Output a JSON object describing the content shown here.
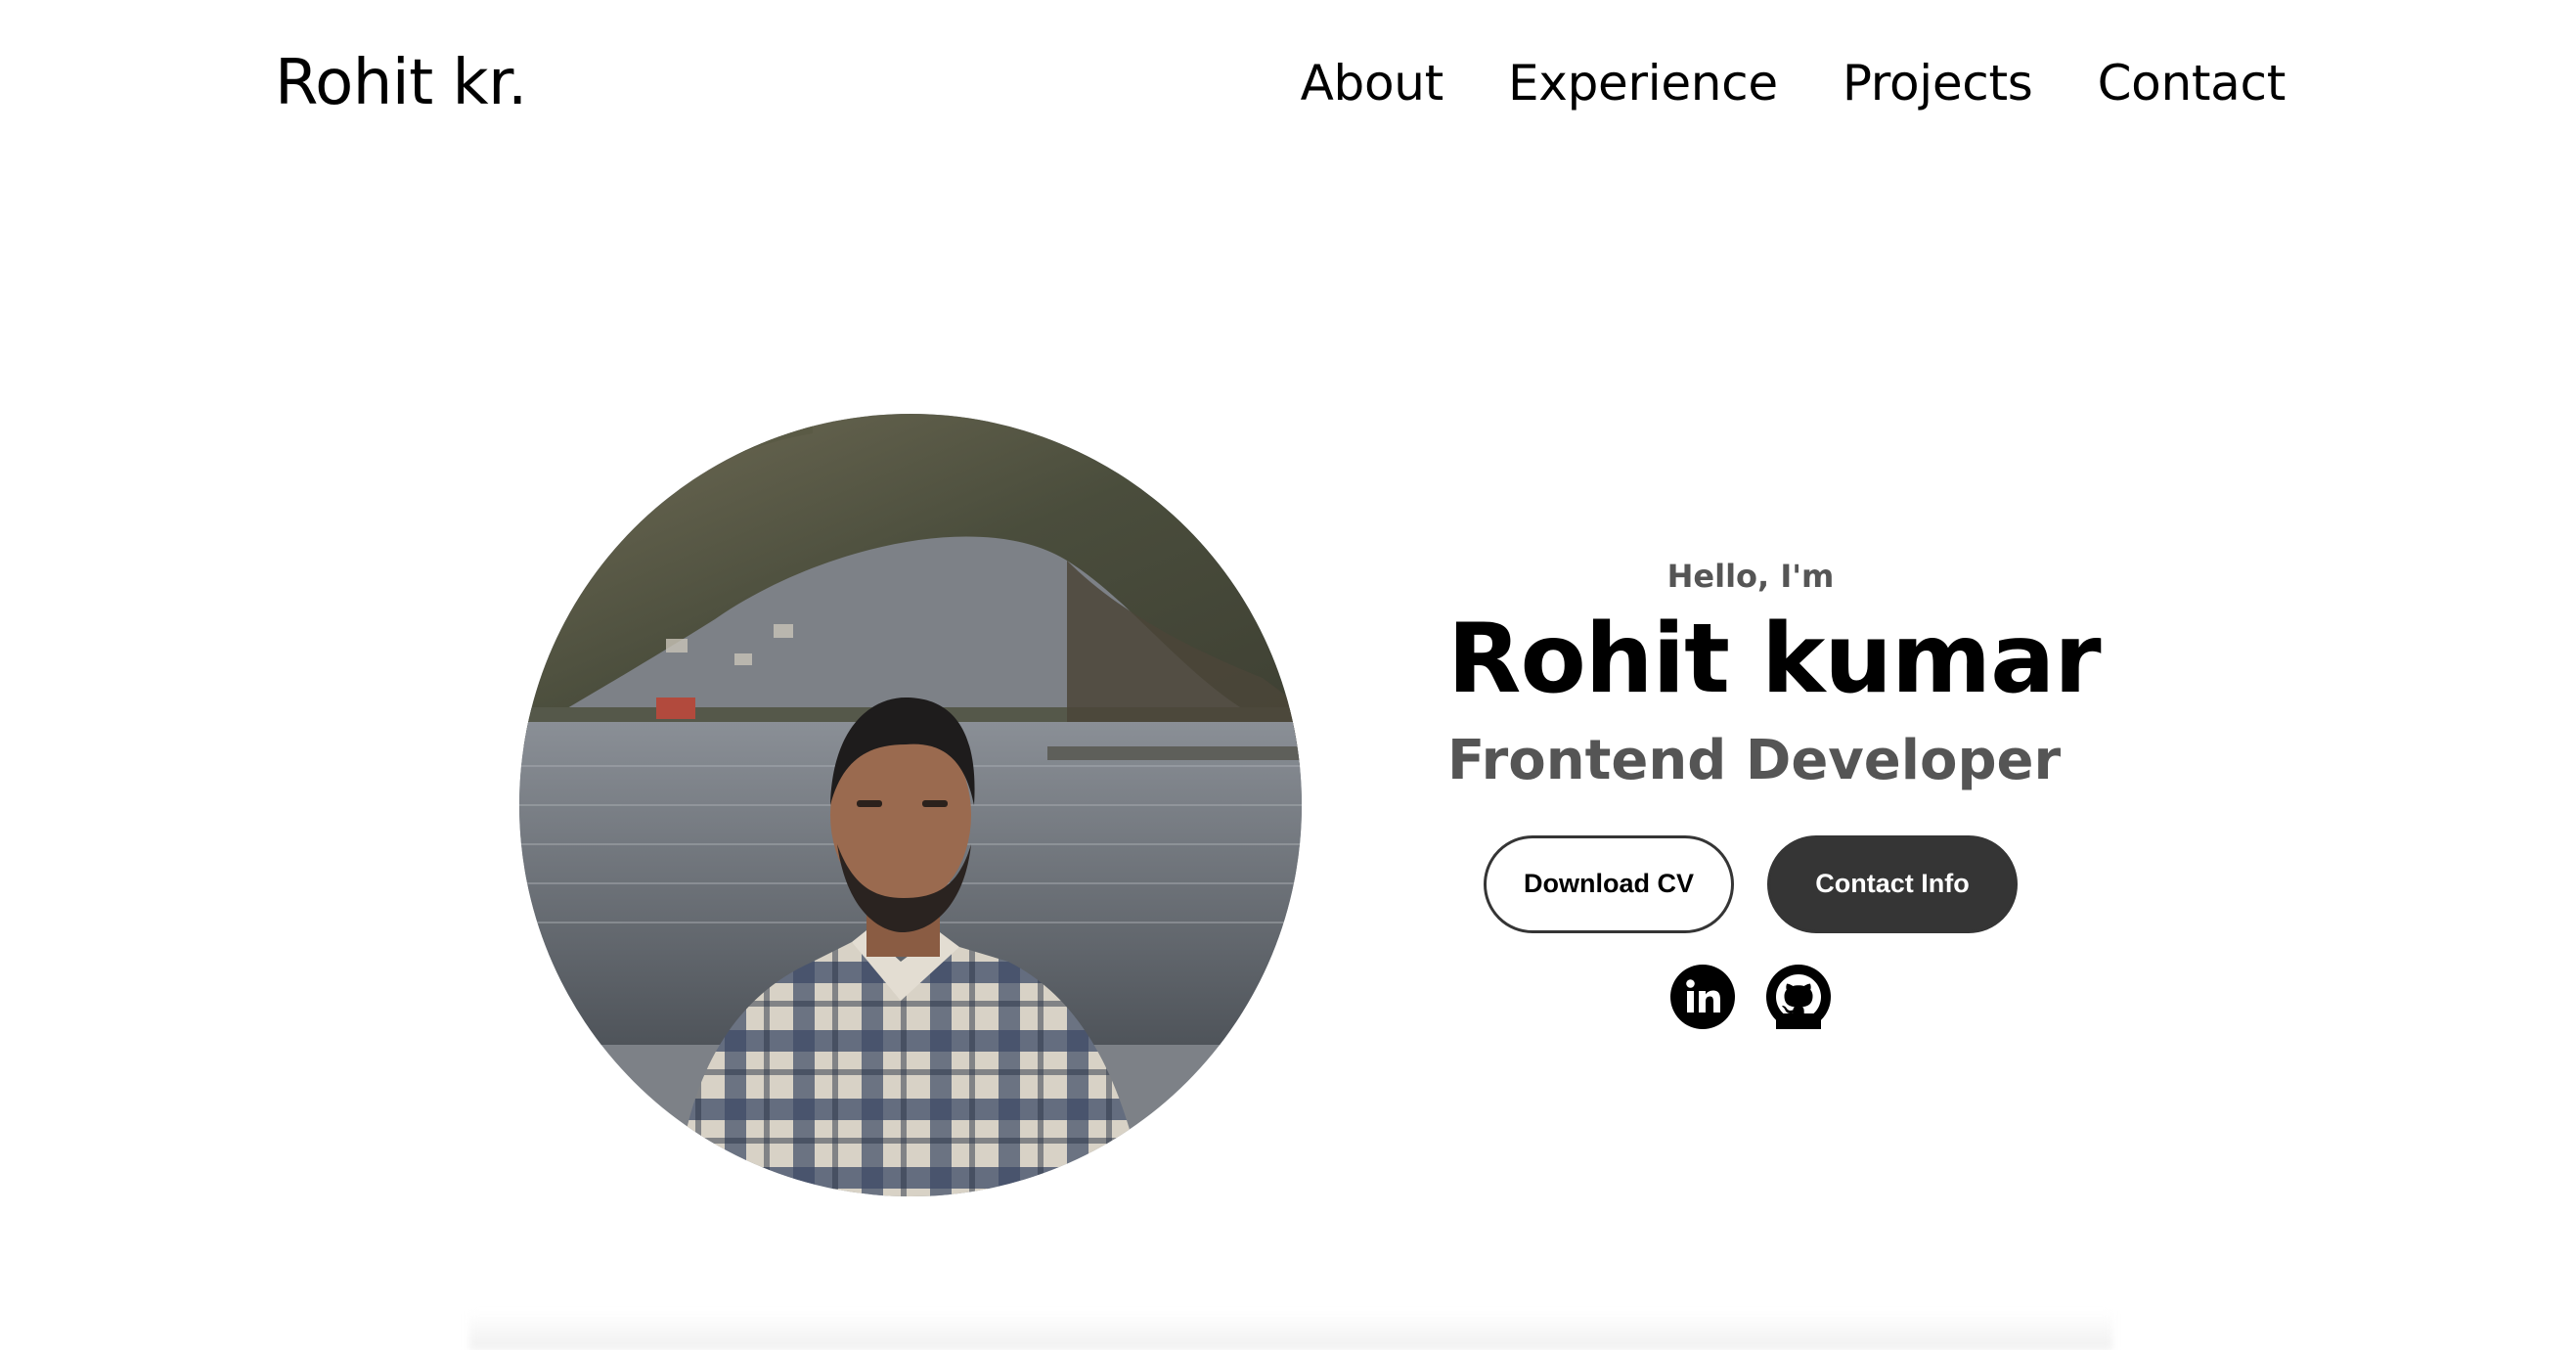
{
  "header": {
    "logo": "Rohit kr.",
    "nav": [
      "About",
      "Experience",
      "Projects",
      "Contact"
    ]
  },
  "hero": {
    "greeting": "Hello, I'm",
    "name": "Rohit kumar",
    "role": "Frontend Developer",
    "buttons": {
      "download": "Download CV",
      "contact": "Contact Info"
    },
    "socials": [
      "linkedin-icon",
      "github-icon"
    ],
    "profile_photo_alt": "profile picture"
  },
  "colors": {
    "text": "#000000",
    "muted": "#555555",
    "button_dark": "#353535",
    "background": "#ffffff"
  }
}
